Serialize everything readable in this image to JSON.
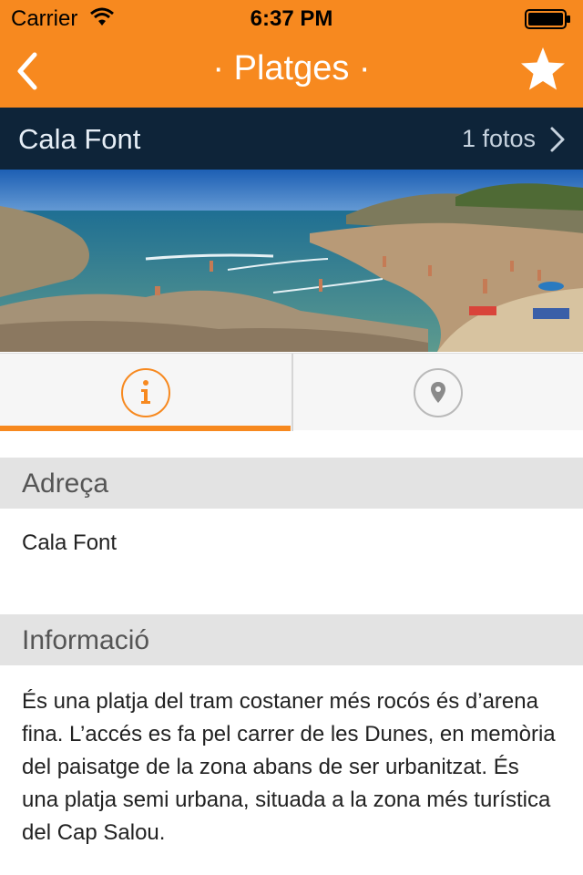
{
  "status_bar": {
    "carrier": "Carrier",
    "time": "6:37 PM"
  },
  "nav": {
    "title": "· Platges ·",
    "back_icon": "chevron-left-icon",
    "favorite_icon": "star-icon"
  },
  "place": {
    "name": "Cala Font",
    "photos_label": "1 fotos"
  },
  "tabs": [
    {
      "name": "info",
      "icon": "info-icon",
      "selected": true
    },
    {
      "name": "map",
      "icon": "map-pin-icon",
      "selected": false
    }
  ],
  "sections": {
    "address": {
      "header": "Adreça",
      "body": "Cala Font"
    },
    "info": {
      "header": "Informació",
      "body": "És una platja del tram costaner més rocós és d’arena fina. L’accés es fa pel carrer de les Dunes, en memòria del paisatge de la zona abans de ser urbanitzat. És una platja semi urbana, situada a la zona més turística del Cap Salou."
    }
  },
  "colors": {
    "accent": "#f7891f",
    "subheader_bg": "#0e2439",
    "section_bg": "#e3e3e3"
  }
}
